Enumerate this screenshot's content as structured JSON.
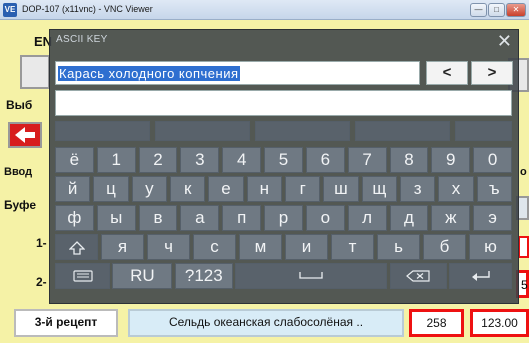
{
  "window": {
    "title": "DOP-107 (x11vnc) - VNC Viewer",
    "icon_text": "VE",
    "controls": [
      "—",
      "□",
      "✕"
    ]
  },
  "background": {
    "top_left": "EN",
    "label_select": "Выб",
    "label_input": "Ввод",
    "label_right_o": "о",
    "label_buffer": "Буфе",
    "row_1": "1-",
    "row_2": "2-",
    "row_2_right": "5",
    "recipe3": {
      "label": "3-й рецепт",
      "name": "Сельдь океанская слабосолёная ..",
      "code": "258",
      "value": "123.00"
    }
  },
  "keyboard": {
    "title": "ASCII KEY",
    "close": "✕",
    "text_value": "Карась  холодного  копчения",
    "second_value": "",
    "prev_label": "<",
    "next_label": ">",
    "rows": [
      [
        "ё",
        "1",
        "2",
        "3",
        "4",
        "5",
        "6",
        "7",
        "8",
        "9",
        "0"
      ],
      [
        "й",
        "ц",
        "у",
        "к",
        "е",
        "н",
        "г",
        "ш",
        "щ",
        "з",
        "х",
        "ъ"
      ],
      [
        "ф",
        "ы",
        "в",
        "а",
        "п",
        "р",
        "о",
        "л",
        "д",
        "ж",
        "э"
      ],
      [
        "shift-icon",
        "я",
        "ч",
        "с",
        "м",
        "и",
        "т",
        "ь",
        "б",
        "ю"
      ],
      [
        "keyboard-icon",
        "RU",
        "?123",
        "space-icon",
        "backspace-icon",
        "enter-icon"
      ]
    ],
    "lang_label": "RU",
    "num_label": "?123"
  }
}
